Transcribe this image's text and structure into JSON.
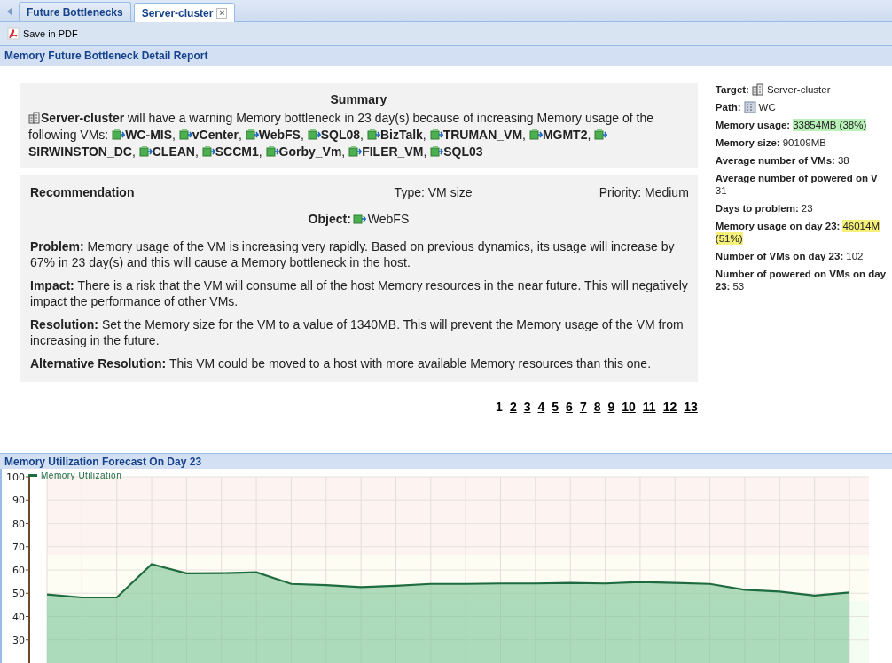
{
  "tabs": [
    {
      "label": "Future Bottlenecks",
      "selected": false
    },
    {
      "label": "Server-cluster",
      "selected": true,
      "close": "×"
    }
  ],
  "toolbar": {
    "save_pdf": "Save in PDF"
  },
  "report_title": "Memory Future Bottleneck Detail Report",
  "summary": {
    "heading": "Summary",
    "target": "Server-cluster",
    "text": [
      "will have a warning Memory bottleneck in 23 day(s) because of increasing Memory usage of the",
      "following VMs:"
    ],
    "vms": [
      {
        "name": "WC-MIS",
        "sep": ","
      },
      {
        "name": "vCenter",
        "sep": ","
      },
      {
        "name": "WebFS",
        "sep": ","
      },
      {
        "name": "SQL08",
        "sep": ","
      },
      {
        "name": "BizTalk",
        "sep": ","
      },
      {
        "name": "TRUMAN_VM",
        "sep": ","
      },
      {
        "name": "MGMT2",
        "sep": ","
      },
      {
        "name": "SIRWINSTON_DC",
        "sep": ","
      },
      {
        "name": "CLEAN",
        "sep": ","
      },
      {
        "name": "SCCM1",
        "sep": ","
      },
      {
        "name": "Gorby_Vm",
        "sep": ","
      },
      {
        "name": "FILER_VM",
        "sep": ","
      },
      {
        "name": "SQL03"
      }
    ]
  },
  "recommendation": {
    "heading": "Recommendation",
    "type": "Type: VM size",
    "priority": "Priority: Medium",
    "object_label": "Object:",
    "object": "WebFS",
    "paragraphs": [
      "**Problem:** Memory usage of the VM is increasing very rapidly. Based on previous dynamics, its usage will increase by 67% in 23 day(s) and this will cause a Memory bottleneck in the host.",
      "**Impact:** There is a risk that the VM will consume all of the host Memory resources in the near future. This will negatively impact the performance of other VMs.",
      "**Resolution:** Set the Memory size for the VM to a value of 1340MB. This will prevent the Memory usage of the VM from increasing in the future.",
      "**Alternative Resolution:** This VM could be moved to a host with more available Memory resources than this one."
    ]
  },
  "pages": [
    {
      "label": "1",
      "selected": true
    },
    {
      "label": "2",
      "selected": false
    },
    {
      "label": "3",
      "selected": false
    },
    {
      "label": "4",
      "selected": false
    },
    {
      "label": "5",
      "selected": false
    },
    {
      "label": "6",
      "selected": false
    },
    {
      "label": "7",
      "selected": false
    },
    {
      "label": "8",
      "selected": false
    },
    {
      "label": "9",
      "selected": false
    },
    {
      "label": "10",
      "selected": false
    },
    {
      "label": "11",
      "selected": false
    },
    {
      "label": "12",
      "selected": false
    },
    {
      "label": "13",
      "selected": false
    }
  ],
  "details": [
    {
      "lines": [
        [
          {
            "text": "Target:",
            "kind": "label"
          },
          {
            "text": "Server-cluster",
            "kind": "cluster"
          }
        ]
      ]
    },
    {
      "lines": [
        [
          {
            "text": "Path:",
            "kind": "label"
          },
          {
            "text": "WC",
            "kind": "building"
          }
        ]
      ]
    },
    {
      "lines": [
        [
          {
            "text": "Memory usage:",
            "kind": "label"
          },
          {
            "text": "33854MB (38%)",
            "kind": "value",
            "color": "#b8f0b8"
          }
        ]
      ]
    },
    {
      "lines": [
        [
          {
            "text": "Memory size:",
            "kind": "label"
          },
          {
            "text": "90109MB",
            "kind": "value"
          }
        ]
      ]
    },
    {
      "lines": [
        [
          {
            "text": "Average number of VMs:",
            "kind": "label"
          },
          {
            "text": "38",
            "kind": "value"
          }
        ]
      ]
    },
    {
      "lines": [
        [
          {
            "text": "Average number of powered on V",
            "kind": "label"
          }
        ],
        [
          {
            "text": "31",
            "kind": "value"
          }
        ]
      ]
    },
    {
      "lines": [
        [
          {
            "text": "Days to problem:",
            "kind": "label"
          },
          {
            "text": "23",
            "kind": "value"
          }
        ]
      ]
    },
    {
      "lines": [
        [
          {
            "text": "Memory usage on day 23:",
            "kind": "label"
          },
          {
            "text": "46014M",
            "kind": "value",
            "color": "#f5f07a"
          }
        ],
        [
          {
            "text": "(51%)",
            "kind": "value",
            "color": "#f5f07a"
          }
        ]
      ]
    },
    {
      "lines": [
        [
          {
            "text": "Number of VMs on day 23:",
            "kind": "label"
          },
          {
            "text": "102",
            "kind": "value"
          }
        ]
      ]
    },
    {
      "lines": [
        [
          {
            "text": "Number of powered on VMs on day",
            "kind": "label"
          }
        ],
        [
          {
            "text": "23:",
            "kind": "label"
          },
          {
            "text": "53",
            "kind": "value"
          }
        ]
      ]
    }
  ],
  "forecast": {
    "title": "Memory Utilization Forecast On Day 23",
    "chart_data": {
      "type": "area",
      "grid": true,
      "series": [
        {
          "name": "Memory Utilization",
          "color": "#1e6b40",
          "values": [
            49.5,
            48.2,
            48.2,
            62.5,
            58.5,
            58.6,
            59,
            54,
            53.5,
            52.6,
            53.2,
            54,
            54,
            54.2,
            54.2,
            54.4,
            54.2,
            54.8,
            54.4,
            54,
            51.5,
            50.7,
            49,
            50.3
          ]
        }
      ],
      "ylim": [
        20,
        100
      ],
      "yticks": [
        30,
        40,
        50,
        60,
        70,
        80,
        90,
        100
      ]
    }
  }
}
